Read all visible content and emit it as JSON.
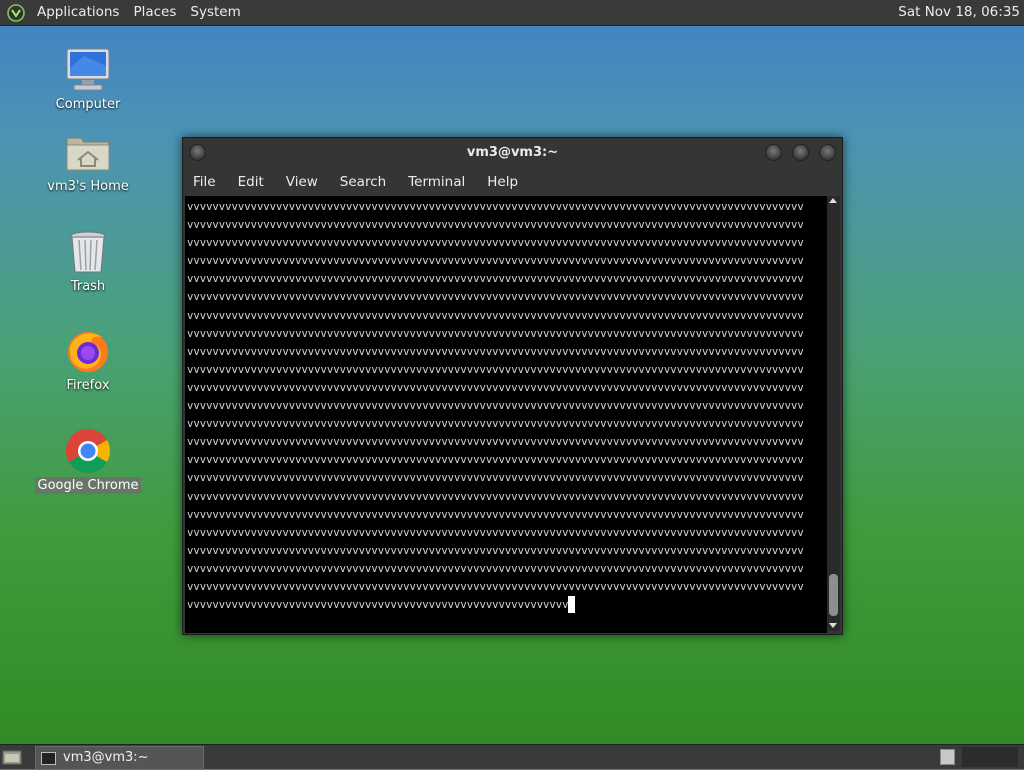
{
  "top_panel": {
    "menus": [
      "Applications",
      "Places",
      "System"
    ],
    "clock": "Sat Nov 18, 06:35"
  },
  "desktop_icons": [
    {
      "label": "Computer",
      "icon": "computer-icon"
    },
    {
      "label": "vm3's Home",
      "icon": "home-folder-icon"
    },
    {
      "label": "Trash",
      "icon": "trash-icon"
    },
    {
      "label": "Firefox",
      "icon": "firefox-icon"
    },
    {
      "label": "Google Chrome",
      "icon": "chrome-icon",
      "selected": true
    }
  ],
  "terminal": {
    "title": "vm3@vm3:~",
    "menu": [
      "File",
      "Edit",
      "View",
      "Search",
      "Terminal",
      "Help"
    ],
    "lines": [
      "vvvvvvvvvvvvvvvvvvvvvvvvvvvvvvvvvvvvvvvvvvvvvvvvvvvvvvvvvvvvvvvvvvvvvvvvvvvvvvvvvvvvvvvvvvvvvvvvv",
      "vvvvvvvvvvvvvvvvvvvvvvvvvvvvvvvvvvvvvvvvvvvvvvvvvvvvvvvvvvvvvvvvvvvvvvvvvvvvvvvvvvvvvvvvvvvvvvvvv",
      "vvvvvvvvvvvvvvvvvvvvvvvvvvvvvvvvvvvvvvvvvvvvvvvvvvvvvvvvvvvvvvvvvvvvvvvvvvvvvvvvvvvvvvvvvvvvvvvvv",
      "vvvvvvvvvvvvvvvvvvvvvvvvvvvvvvvvvvvvvvvvvvvvvvvvvvvvvvvvvvvvvvvvvvvvvvvvvvvvvvvvvvvvvvvvvvvvvvvvv",
      "vvvvvvvvvvvvvvvvvvvvvvvvvvvvvvvvvvvvvvvvvvvvvvvvvvvvvvvvvvvvvvvvvvvvvvvvvvvvvvvvvvvvvvvvvvvvvvvvv",
      "vvvvvvvvvvvvvvvvvvvvvvvvvvvvvvvvvvvvvvvvvvvvvvvvvvvvvvvvvvvvvvvvvvvvvvvvvvvvvvvvvvvvvvvvvvvvvvvvv",
      "vvvvvvvvvvvvvvvvvvvvvvvvvvvvvvvvvvvvvvvvvvvvvvvvvvvvvvvvvvvvvvvvvvvvvvvvvvvvvvvvvvvvvvvvvvvvvvvvv",
      "vvvvvvvvvvvvvvvvvvvvvvvvvvvvvvvvvvvvvvvvvvvvvvvvvvvvvvvvvvvvvvvvvvvvvvvvvvvvvvvvvvvvvvvvvvvvvvvvv",
      "vvvvvvvvvvvvvvvvvvvvvvvvvvvvvvvvvvvvvvvvvvvvvvvvvvvvvvvvvvvvvvvvvvvvvvvvvvvvvvvvvvvvvvvvvvvvvvvvv",
      "vvvvvvvvvvvvvvvvvvvvvvvvvvvvvvvvvvvvvvvvvvvvvvvvvvvvvvvvvvvvvvvvvvvvvvvvvvvvvvvvvvvvvvvvvvvvvvvvv",
      "vvvvvvvvvvvvvvvvvvvvvvvvvvvvvvvvvvvvvvvvvvvvvvvvvvvvvvvvvvvvvvvvvvvvvvvvvvvvvvvvvvvvvvvvvvvvvvvvv",
      "vvvvvvvvvvvvvvvvvvvvvvvvvvvvvvvvvvvvvvvvvvvvvvvvvvvvvvvvvvvvvvvvvvvvvvvvvvvvvvvvvvvvvvvvvvvvvvvvv",
      "vvvvvvvvvvvvvvvvvvvvvvvvvvvvvvvvvvvvvvvvvvvvvvvvvvvvvvvvvvvvvvvvvvvvvvvvvvvvvvvvvvvvvvvvvvvvvvvvv",
      "vvvvvvvvvvvvvvvvvvvvvvvvvvvvvvvvvvvvvvvvvvvvvvvvvvvvvvvvvvvvvvvvvvvvvvvvvvvvvvvvvvvvvvvvvvvvvvvvv",
      "vvvvvvvvvvvvvvvvvvvvvvvvvvvvvvvvvvvvvvvvvvvvvvvvvvvvvvvvvvvvvvvvvvvvvvvvvvvvvvvvvvvvvvvvvvvvvvvvv",
      "vvvvvvvvvvvvvvvvvvvvvvvvvvvvvvvvvvvvvvvvvvvvvvvvvvvvvvvvvvvvvvvvvvvvvvvvvvvvvvvvvvvvvvvvvvvvvvvvv",
      "vvvvvvvvvvvvvvvvvvvvvvvvvvvvvvvvvvvvvvvvvvvvvvvvvvvvvvvvvvvvvvvvvvvvvvvvvvvvvvvvvvvvvvvvvvvvvvvvv",
      "vvvvvvvvvvvvvvvvvvvvvvvvvvvvvvvvvvvvvvvvvvvvvvvvvvvvvvvvvvvvvvvvvvvvvvvvvvvvvvvvvvvvvvvvvvvvvvvvv",
      "vvvvvvvvvvvvvvvvvvvvvvvvvvvvvvvvvvvvvvvvvvvvvvvvvvvvvvvvvvvvvvvvvvvvvvvvvvvvvvvvvvvvvvvvvvvvvvvvv",
      "vvvvvvvvvvvvvvvvvvvvvvvvvvvvvvvvvvvvvvvvvvvvvvvvvvvvvvvvvvvvvvvvvvvvvvvvvvvvvvvvvvvvvvvvvvvvvvvvv",
      "vvvvvvvvvvvvvvvvvvvvvvvvvvvvvvvvvvvvvvvvvvvvvvvvvvvvvvvvvvvvvvvvvvvvvvvvvvvvvvvvvvvvvvvvvvvvvvvvv",
      "vvvvvvvvvvvvvvvvvvvvvvvvvvvvvvvvvvvvvvvvvvvvvvvvvvvvvvvvvvvvvvvvvvvvvvvvvvvvvvvvvvvvvvvvvvvvvvvvv",
      "vvvvvvvvvvvvvvvvvvvvvvvvvvvvvvvvvvvvvvvvvvvvvvvvvvvvvvvvvvvv"
    ]
  },
  "taskbar": {
    "task_label": "vm3@vm3:~"
  }
}
